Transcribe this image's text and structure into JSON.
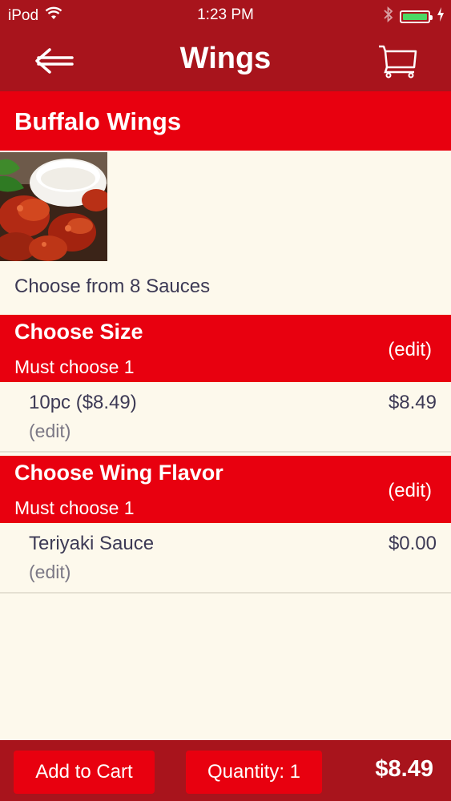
{
  "status_bar": {
    "carrier": "iPod",
    "time": "1:23 PM",
    "icons": [
      "wifi-icon",
      "bluetooth-icon",
      "battery-icon",
      "charging-icon"
    ],
    "battery_level": 1.0
  },
  "nav": {
    "title": "Wings",
    "back_icon": "back-arrow-icon",
    "cart_icon": "cart-icon"
  },
  "item": {
    "name": "Buffalo Wings",
    "description": "Choose from 8 Sauces"
  },
  "groups": [
    {
      "title": "Choose Size",
      "subtitle": "Must choose 1",
      "edit_label": "(edit)",
      "choice": {
        "name": "10pc ($8.49)",
        "price": "$8.49",
        "edit_label": "(edit)"
      }
    },
    {
      "title": "Choose Wing Flavor",
      "subtitle": "Must choose 1",
      "edit_label": "(edit)",
      "choice": {
        "name": "Teriyaki Sauce",
        "price": "$0.00",
        "edit_label": "(edit)"
      }
    }
  ],
  "bottom": {
    "add_to_cart_label": "Add to Cart",
    "quantity_label": "Quantity: 1",
    "total": "$8.49"
  },
  "colors": {
    "bar_dark_red": "#a8141c",
    "header_red": "#e8000f",
    "background": "#fdf9ec",
    "battery_green": "#4cd964"
  }
}
